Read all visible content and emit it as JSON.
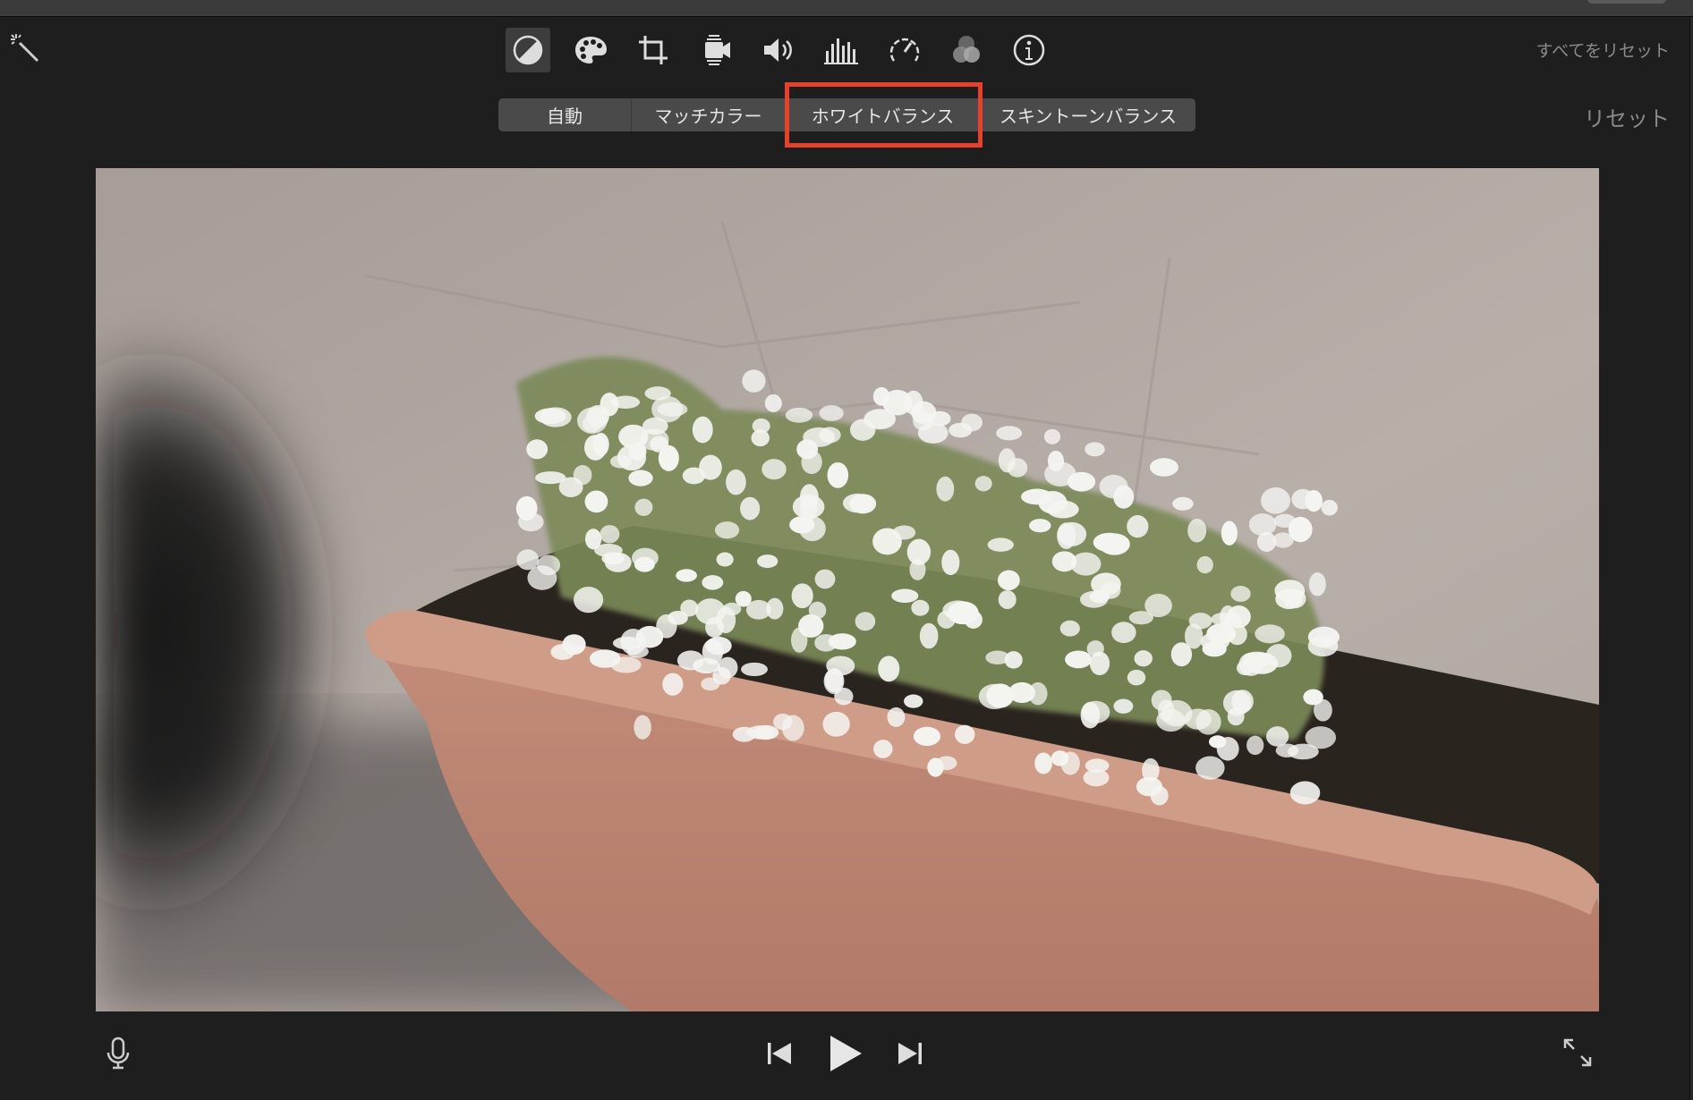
{
  "toolbar": {
    "tools": [
      {
        "name": "color-balance",
        "active": true
      },
      {
        "name": "color-correction"
      },
      {
        "name": "crop"
      },
      {
        "name": "stabilization"
      },
      {
        "name": "volume"
      },
      {
        "name": "noise-reduction-equalizer"
      },
      {
        "name": "speed"
      },
      {
        "name": "video-overlay"
      },
      {
        "name": "clip-info"
      }
    ],
    "reset_all": "すべてをリセット"
  },
  "color_balance": {
    "segments": [
      "自動",
      "マッチカラー",
      "ホワイトバランス",
      "スキントーンバランス"
    ],
    "highlighted": "ホワイトバランス",
    "reset": "リセット"
  },
  "colors": {
    "highlight": "#e8412b",
    "background": "#1e1e1e"
  }
}
